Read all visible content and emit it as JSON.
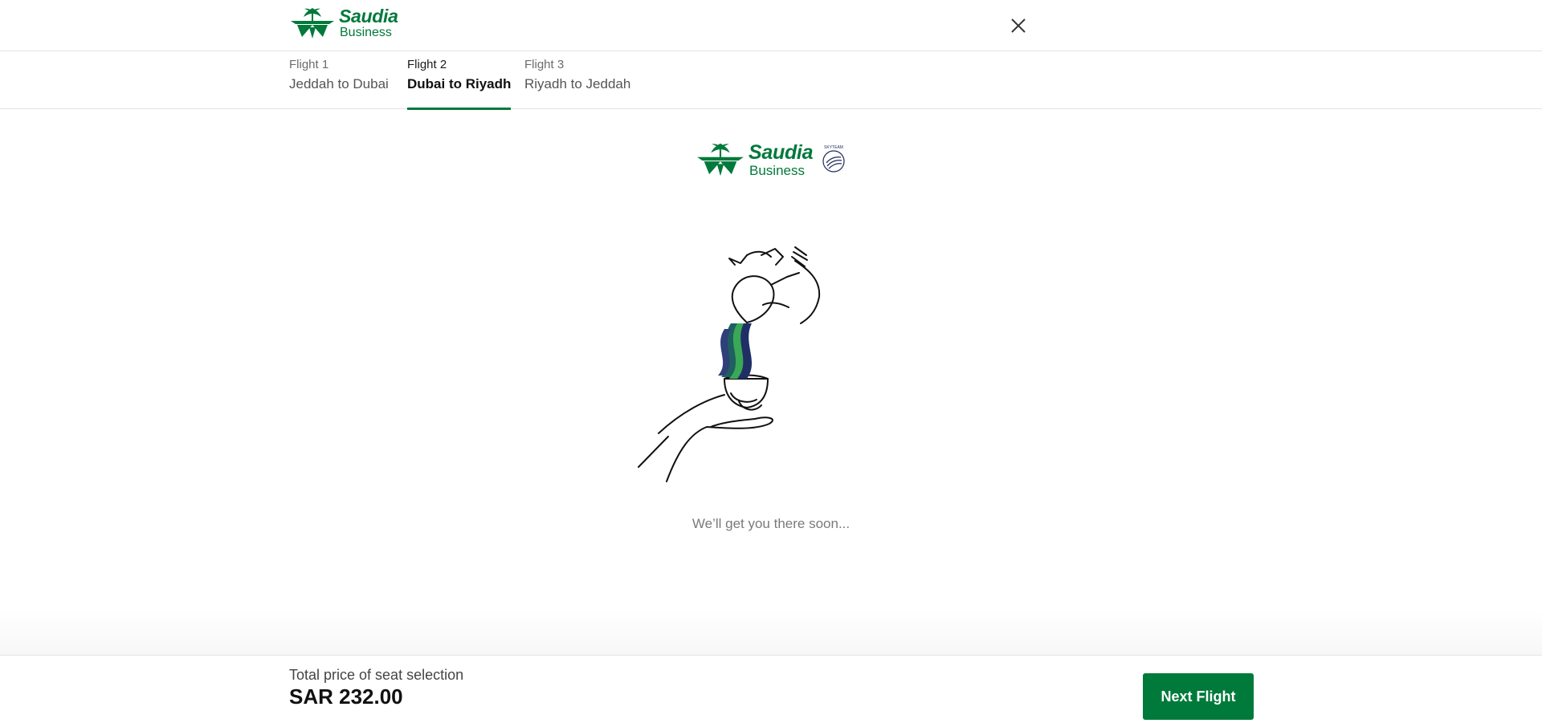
{
  "header": {
    "logo": {
      "brand": "Saudia",
      "sub": "Business"
    }
  },
  "tabs": [
    {
      "flight": "Flight 1",
      "route": "Jeddah to Dubai",
      "active": false
    },
    {
      "flight": "Flight 2",
      "route": "Dubai to Riyadh",
      "active": true
    },
    {
      "flight": "Flight 3",
      "route": "Riyadh to Jeddah",
      "active": false
    }
  ],
  "loading": {
    "logo": {
      "brand": "Saudia",
      "sub": "Business",
      "alliance": "SKYTEAM"
    },
    "message": "We’ll get you there soon..."
  },
  "footer": {
    "price_label": "Total price of seat selection",
    "price_value": "SAR 232.00",
    "next_label": "Next Flight"
  },
  "colors": {
    "brand_green": "#00793b",
    "button_green": "#007a3a"
  }
}
